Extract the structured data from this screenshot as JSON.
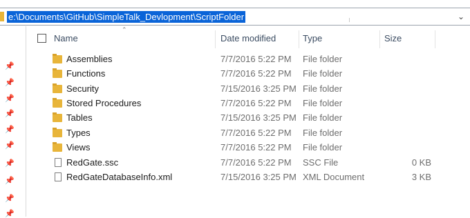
{
  "address": {
    "path": "e:\\Documents\\GitHub\\SimpleTalk_Devlopment\\ScriptFolder",
    "dropdown_icon": "chevron-down-icon"
  },
  "columns": {
    "name": "Name",
    "date": "Date modified",
    "type": "Type",
    "size": "Size"
  },
  "files": [
    {
      "name": "Assemblies",
      "date": "7/7/2016 5:22 PM",
      "type": "File folder",
      "size": "",
      "icon": "folder-icon"
    },
    {
      "name": "Functions",
      "date": "7/7/2016 5:22 PM",
      "type": "File folder",
      "size": "",
      "icon": "folder-icon"
    },
    {
      "name": "Security",
      "date": "7/15/2016 3:25 PM",
      "type": "File folder",
      "size": "",
      "icon": "folder-icon"
    },
    {
      "name": "Stored Procedures",
      "date": "7/7/2016 5:22 PM",
      "type": "File folder",
      "size": "",
      "icon": "folder-icon"
    },
    {
      "name": "Tables",
      "date": "7/15/2016 3:25 PM",
      "type": "File folder",
      "size": "",
      "icon": "folder-icon"
    },
    {
      "name": "Types",
      "date": "7/7/2016 5:22 PM",
      "type": "File folder",
      "size": "",
      "icon": "folder-icon"
    },
    {
      "name": "Views",
      "date": "7/7/2016 5:22 PM",
      "type": "File folder",
      "size": "",
      "icon": "folder-icon"
    },
    {
      "name": "RedGate.ssc",
      "date": "7/7/2016 5:22 PM",
      "type": "SSC File",
      "size": "0 KB",
      "icon": "file-icon"
    },
    {
      "name": "RedGateDatabaseInfo.xml",
      "date": "7/15/2016 3:25 PM",
      "type": "XML Document",
      "size": "3 KB",
      "icon": "file-icon"
    }
  ],
  "colors": {
    "selection": "#0a64d8",
    "folder": "#e8b53a",
    "header_text": "#3a4b61",
    "muted_text": "#6d6d6d"
  }
}
